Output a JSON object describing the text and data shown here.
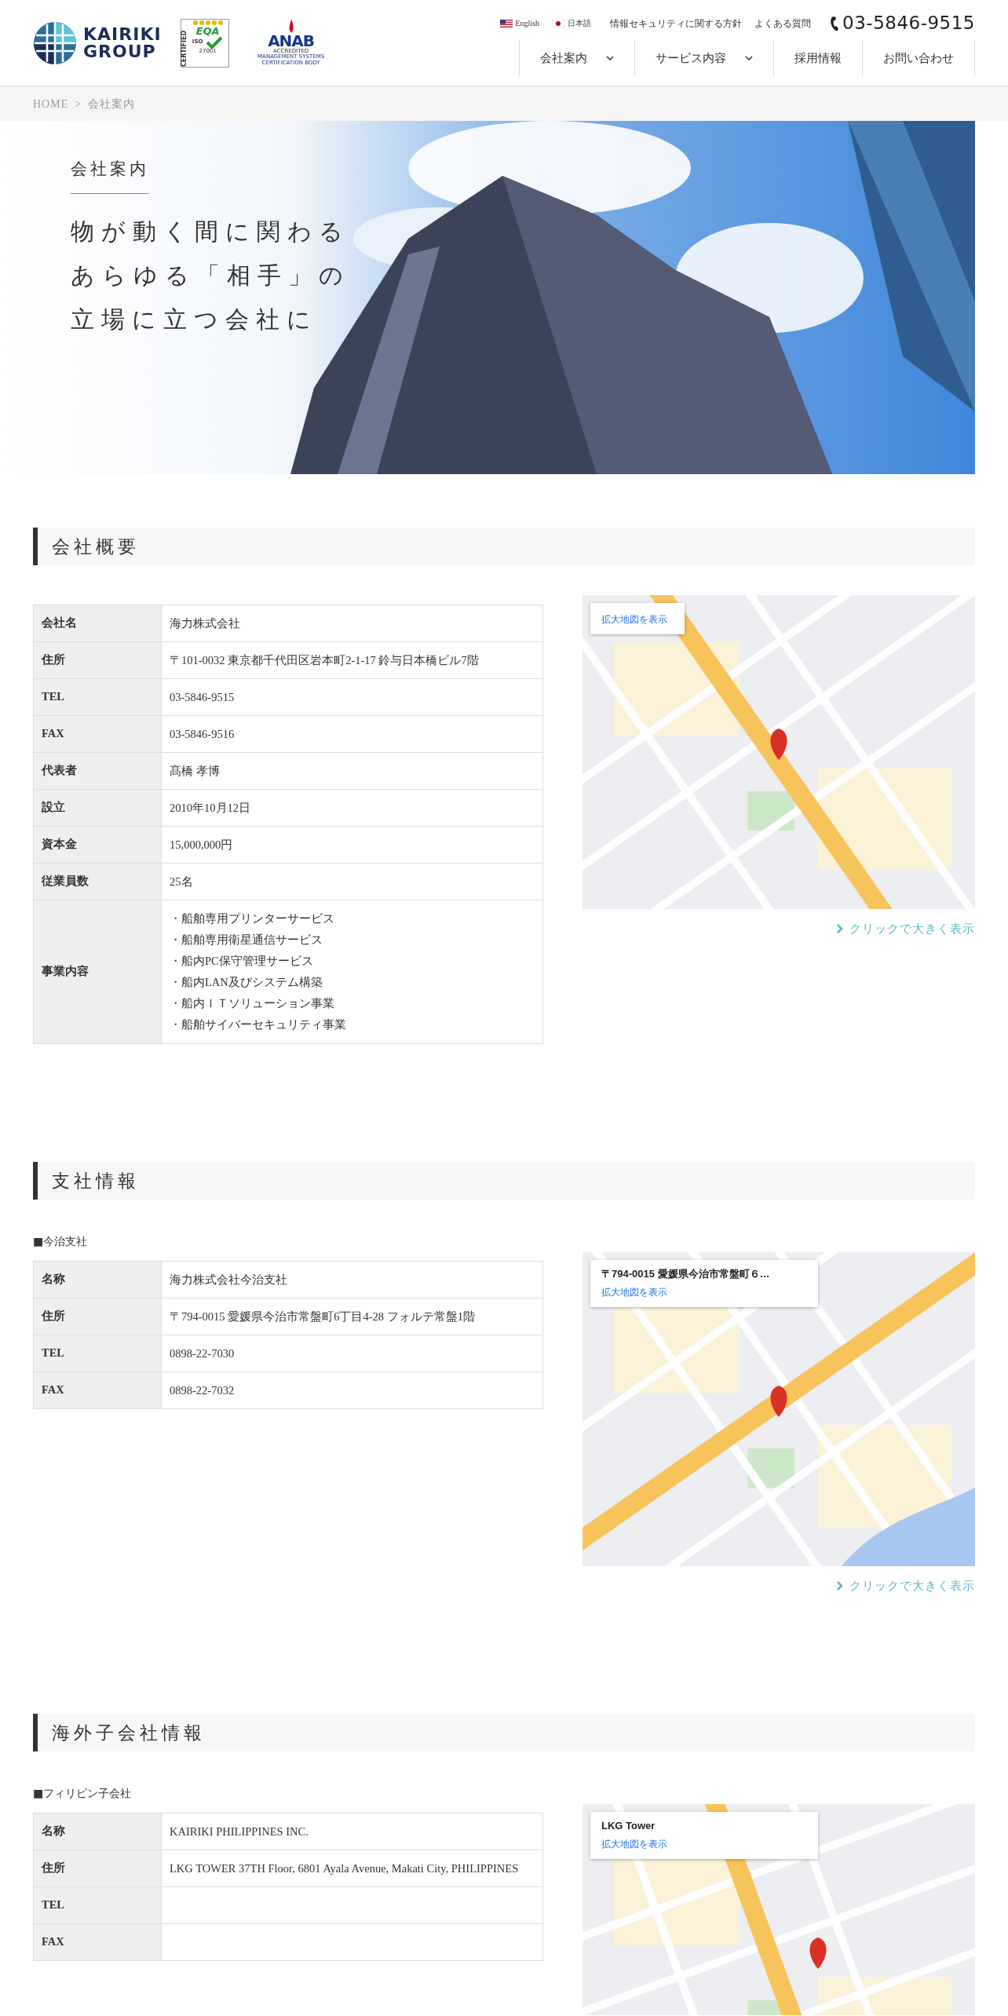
{
  "header": {
    "logo": {
      "line_1": "KAIRIKI",
      "line_2": "GROUP"
    },
    "certification": {
      "side_text": "CERTIFIED",
      "mark": "EQA",
      "standard": "ISO",
      "number": "27001"
    },
    "accreditation": {
      "mark": "ANAB",
      "subtitle": "ACCREDITED",
      "caption": "MANAGEMENT SYSTEMS CERTIFICATION BODY"
    },
    "languages": [
      {
        "label": "English",
        "kind": "us"
      },
      {
        "label": "日本語",
        "kind": "jp"
      }
    ],
    "top_links": [
      "情報セキュリティに関する方針",
      "よくある質問"
    ],
    "phone": "03-5846-9515",
    "nav": [
      {
        "label": "会社案内",
        "dropdown": true
      },
      {
        "label": "サービス内容",
        "dropdown": true
      },
      {
        "label": "採用情報",
        "dropdown": false
      },
      {
        "label": "お問い合わせ",
        "dropdown": false
      }
    ]
  },
  "breadcrumb": {
    "items": [
      "HOME",
      "会社案内"
    ],
    "separator": ">"
  },
  "hero": {
    "label": "会社案内",
    "lines": [
      "物が動く間に関わる",
      "あらゆる「相手」の",
      "立場に立つ会社に"
    ]
  },
  "sections": [
    {
      "title": "会社概要",
      "rows": [
        {
          "label": "会社名",
          "value": "海力株式会社"
        },
        {
          "label": "住所",
          "value": "〒101-0032 東京都千代田区岩本町2-1-17 鈴与日本橋ビル7階"
        },
        {
          "label": "TEL",
          "value": "03-5846-9515"
        },
        {
          "label": "FAX",
          "value": "03-5846-9516"
        },
        {
          "label": "代表者",
          "value": "髙橋 孝博"
        },
        {
          "label": "設立",
          "value": "2010年10月12日"
        },
        {
          "label": "資本金",
          "value": "15,000,000円"
        },
        {
          "label": "従業員数",
          "value": "25名"
        },
        {
          "label": "事業内容",
          "lines": [
            "・船舶専用プリンターサービス",
            "・船舶専用衛星通信サービス",
            "・船内PC保守管理サービス",
            "・船内LAN及びシステム構築",
            "・船内ＩＴソリューション事業",
            "・船舶サイバーセキュリティ事業"
          ]
        }
      ],
      "map": {
        "card_link": "拡大地図を表示"
      },
      "map_link": "クリックで大きく表示"
    },
    {
      "title": "支社情報",
      "subtitle": "■今治支社",
      "rows": [
        {
          "label": "名称",
          "value": "海力株式会社今治支社"
        },
        {
          "label": "住所",
          "value": "〒794-0015 愛媛県今治市常盤町6丁目4-28 フォルテ常盤1階"
        },
        {
          "label": "TEL",
          "value": "0898-22-7030"
        },
        {
          "label": "FAX",
          "value": "0898-22-7032"
        }
      ],
      "map": {
        "card_title": "〒794-0015 愛媛県今治市常盤町６…",
        "card_link": "拡大地図を表示"
      },
      "map_link": "クリックで大きく表示"
    },
    {
      "title": "海外子会社情報",
      "subtitle": "■フィリピン子会社",
      "rows": [
        {
          "label": "名称",
          "value": "KAIRIKI PHILIPPINES INC."
        },
        {
          "label": "住所",
          "value": "LKG TOWER 37TH Floor, 6801 Ayala Avenue, Makati City, PHILIPPINES"
        },
        {
          "label": "TEL"
        },
        {
          "label": "FAX"
        }
      ],
      "map": {
        "card_title": "LKG Tower",
        "card_link": "拡大地図を表示"
      }
    }
  ]
}
